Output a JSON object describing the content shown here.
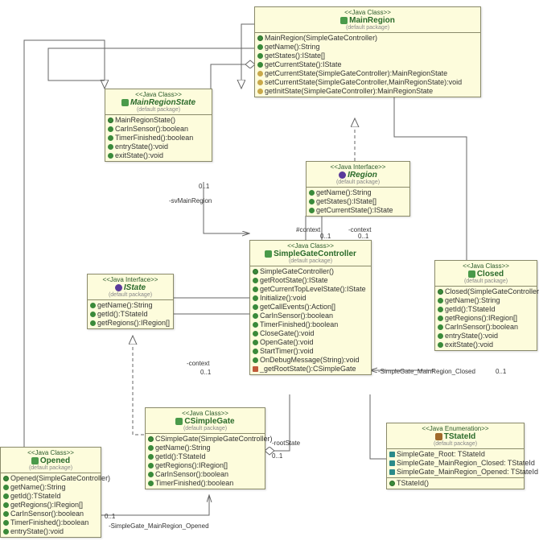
{
  "stereotypes": {
    "class": "<<Java Class>>",
    "iface": "<<Java Interface>>",
    "enum": "<<Java Enumeration>>"
  },
  "pkg": "(default package)",
  "classes": {
    "MainRegion": {
      "name": "MainRegion",
      "members": [
        {
          "v": "ctor",
          "t": "MainRegion(SimpleGateController)"
        },
        {
          "v": "pub",
          "t": "getName():String"
        },
        {
          "v": "pub",
          "t": "getStates():IState[]"
        },
        {
          "v": "pub",
          "t": "getCurrentState():IState"
        },
        {
          "v": "prot",
          "t": "getCurrentState(SimpleGateController):MainRegionState"
        },
        {
          "v": "prot",
          "t": "setCurrentState(SimpleGateController,MainRegionState):void"
        },
        {
          "v": "prot",
          "t": "getInitState(SimpleGateController):MainRegionState"
        }
      ]
    },
    "MainRegionState": {
      "name": "MainRegionState",
      "members": [
        {
          "v": "ctor",
          "t": "MainRegionState()"
        },
        {
          "v": "pub",
          "t": "CarInSensor():boolean"
        },
        {
          "v": "pub",
          "t": "TimerFinished():boolean"
        },
        {
          "v": "pub",
          "t": "entryState():void"
        },
        {
          "v": "pub",
          "t": "exitState():void"
        }
      ]
    },
    "IRegion": {
      "name": "IRegion",
      "members": [
        {
          "v": "pub",
          "t": "getName():String"
        },
        {
          "v": "pub",
          "t": "getStates():IState[]"
        },
        {
          "v": "pub",
          "t": "getCurrentState():IState"
        }
      ]
    },
    "SimpleGateController": {
      "name": "SimpleGateController",
      "members": [
        {
          "v": "ctor",
          "t": "SimpleGateController()"
        },
        {
          "v": "pub",
          "t": "getRootState():IState"
        },
        {
          "v": "pub",
          "t": "getCurrentTopLevelState():IState"
        },
        {
          "v": "pub",
          "t": "Initialize():void"
        },
        {
          "v": "pub",
          "t": "getCallEvents():Action[]"
        },
        {
          "v": "pub",
          "t": "CarInSensor():boolean"
        },
        {
          "v": "pub",
          "t": "TimerFinished():boolean"
        },
        {
          "v": "pub",
          "t": "CloseGate():void"
        },
        {
          "v": "pub",
          "t": "OpenGate():void"
        },
        {
          "v": "pub",
          "t": "StartTimer():void"
        },
        {
          "v": "pub",
          "t": "OnDebugMessage(String):void"
        },
        {
          "v": "stat",
          "t": "_getRootState():CSimpleGate"
        }
      ]
    },
    "IState": {
      "name": "IState",
      "members": [
        {
          "v": "pub",
          "t": "getName():String"
        },
        {
          "v": "pub",
          "t": "getId():TStateId"
        },
        {
          "v": "pub",
          "t": "getRegions():IRegion[]"
        }
      ]
    },
    "Closed": {
      "name": "Closed",
      "members": [
        {
          "v": "ctor",
          "t": "Closed(SimpleGateController)"
        },
        {
          "v": "pub",
          "t": "getName():String"
        },
        {
          "v": "pub",
          "t": "getId():TStateId"
        },
        {
          "v": "pub",
          "t": "getRegions():IRegion[]"
        },
        {
          "v": "pub",
          "t": "CarInSensor():boolean"
        },
        {
          "v": "pub",
          "t": "entryState():void"
        },
        {
          "v": "pub",
          "t": "exitState():void"
        }
      ]
    },
    "CSimpleGate": {
      "name": "CSimpleGate",
      "members": [
        {
          "v": "ctor",
          "t": "CSimpleGate(SimpleGateController)"
        },
        {
          "v": "pub",
          "t": "getName():String"
        },
        {
          "v": "pub",
          "t": "getId():TStateId"
        },
        {
          "v": "pub",
          "t": "getRegions():IRegion[]"
        },
        {
          "v": "pub",
          "t": "CarInSensor():boolean"
        },
        {
          "v": "pub",
          "t": "TimerFinished():boolean"
        }
      ]
    },
    "Opened": {
      "name": "Opened",
      "members": [
        {
          "v": "ctor",
          "t": "Opened(SimpleGateController)"
        },
        {
          "v": "pub",
          "t": "getName():String"
        },
        {
          "v": "pub",
          "t": "getId():TStateId"
        },
        {
          "v": "pub",
          "t": "getRegions():IRegion[]"
        },
        {
          "v": "pub",
          "t": "CarInSensor():boolean"
        },
        {
          "v": "pub",
          "t": "TimerFinished():boolean"
        },
        {
          "v": "pub",
          "t": "entryState():void"
        }
      ]
    },
    "TStateId": {
      "name": "TStateId",
      "literals": [
        "SimpleGate_Root: TStateId",
        "SimpleGate_MainRegion_Closed: TStateId",
        "SimpleGate_MainRegion_Opened: TStateId"
      ],
      "members": [
        {
          "v": "ctor",
          "t": "TStateId()"
        }
      ]
    }
  },
  "edgeLabels": {
    "svMainRegion": "-svMainRegion",
    "contextHash": "#context",
    "context": "-context",
    "rootState": "-rootState",
    "closedEdge": "-SimpleGate_MainRegion_Closed",
    "openedEdge": "-SimpleGate_MainRegion_Opened",
    "mult01a": "0..1",
    "mult01b": "0..1",
    "mult01c": "0..1",
    "mult01d": "0..1",
    "mult01e": "0..1",
    "mult01f": "0..1",
    "mult01g": "0..1"
  }
}
